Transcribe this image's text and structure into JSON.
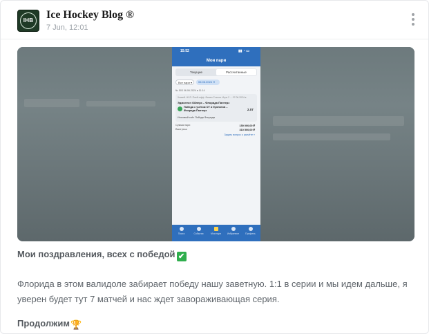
{
  "channel": {
    "name": "Ice Hockey Blog ®",
    "time": "7 Jun, 12:01",
    "avatar_text": "IHB"
  },
  "menu": {
    "icon": "more-vertical-icon"
  },
  "media": {
    "statusbar_time": "15:52",
    "screen_title": "Мои пари",
    "tabs": [
      "Текущие",
      "Рассчитанные"
    ],
    "filters": [
      "Все пари",
      "06.06.2024"
    ],
    "bet_header": "№ 503  06.06.2024 в 11:14",
    "card": {
      "league": "Хоккей. НХЛ. Плей-офф. Финал Стэнли. Игра 2 ... 07.06.2024 в",
      "match": "Эдмонтон Ойлерз – Флорида Пантерз",
      "pick": "Победа с учётом ОТ и буллитов – Флорида Пантерз",
      "odds": "2.07",
      "result": "Итоговый счёт  Победа Флориды"
    },
    "rows": [
      {
        "label": "Сумма пари",
        "value": "150 000,00 ₽"
      },
      {
        "label": "Выигрыш",
        "value": "310 500,00 ₽"
      }
    ],
    "link": "Задать вопрос о расчёте »",
    "tabbar": [
      "Поиск",
      "События",
      "Мои пари",
      "Избранное",
      "Профиль"
    ]
  },
  "caption": {
    "title": "Мои поздравления, всех с победой",
    "title_emoji": "✔",
    "body": "Флорида в этом валидоле забирает победу нашу заветную. 1:1 в серии и мы идем дальше, я уверен будет тут 7 матчей и нас ждет завораживающая серия.",
    "ending": "Продолжим",
    "ending_emoji": "🏆"
  }
}
